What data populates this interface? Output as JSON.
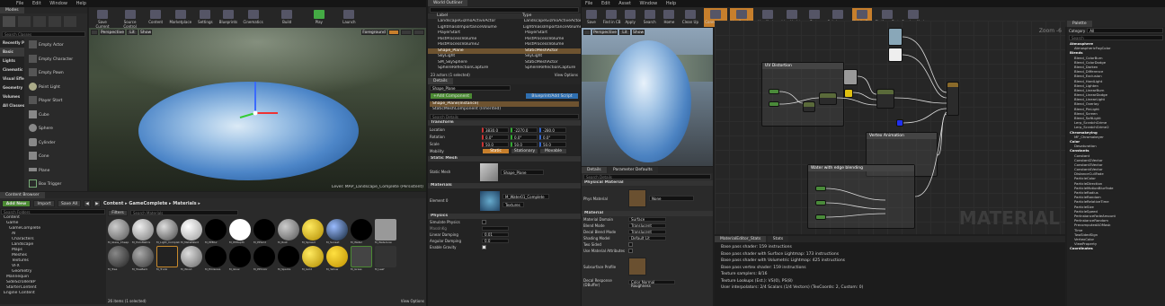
{
  "left": {
    "menu": [
      "File",
      "Edit",
      "Window",
      "Help"
    ],
    "tab": "Modes",
    "search_placeholder": "Search Classes",
    "categories": [
      "Recently Placed",
      "Basic",
      "Lights",
      "Cinematic",
      "Visual Effects",
      "Geometry",
      "Volumes",
      "All Classes"
    ],
    "placeables": [
      "Empty Actor",
      "Empty Character",
      "Empty Pawn",
      "Point Light",
      "Player Start",
      "Cube",
      "Sphere",
      "Cylinder",
      "Cone",
      "Plane",
      "Box Trigger"
    ],
    "toolbar": [
      "Save Current",
      "Source Control",
      "Content",
      "Marketplace",
      "Settings",
      "Blueprints",
      "Cinematics",
      "Build",
      "Play",
      "Launch"
    ],
    "viewport": {
      "perspective": "Perspective",
      "lit": "Lit",
      "show": "Show",
      "foreground": "Foreground",
      "level": "Level: MAP_Landscape_Complete (Persistent)"
    },
    "content_browser": {
      "tab": "Content Browser",
      "add_new": "Add New",
      "import": "Import",
      "save_all": "Save All",
      "path": [
        "Content",
        "GameComplete",
        "Materials"
      ],
      "filters": "Filters",
      "search_placeholder": "Search Materials",
      "folder_search": "Search Folders",
      "tree": [
        "Content",
        "Game",
        "GameComplete",
        "AI",
        "Characters",
        "Landscape",
        "Maps",
        "Meshes",
        "Textures",
        "VFX",
        "Geometry",
        "Mannequin",
        "SideScrollerBP",
        "StarterContent",
        "Engine Content"
      ],
      "assets_row1": [
        "M_Glass_Cheap",
        "M_HoloMatrix",
        "M_Light_Complete",
        "M_MetalWard",
        "M_PPBlur",
        "M_PPDepth",
        "M_PPGrid",
        "M_Rust",
        "M_Spread",
        "M_Sunset",
        "M_Water",
        "M_WaterLow"
      ],
      "assets_row2": [
        "M_Tree",
        "M_TreeBark",
        "M_Trunk",
        "M_Wood",
        "M_Emissive",
        "M_Glow",
        "M_PPColor",
        "M_Sparks",
        "M_Gold",
        "M_Yellow",
        "M_Grass",
        "M_Leaf"
      ],
      "status": "26 items (1 selected)",
      "view_options": "View Options"
    }
  },
  "outliner": {
    "tab": "World Outliner",
    "col_label": "Label",
    "col_type": "Type",
    "rows": [
      {
        "label": "LandscapeGizmoActiveActor",
        "type": "LandscapeGizmoActiveActor"
      },
      {
        "label": "LightmassImportanceVolume",
        "type": "LightmassImportanceVolume"
      },
      {
        "label": "PlayerStart",
        "type": "PlayerStart"
      },
      {
        "label": "PostProcessVolume",
        "type": "PostProcessVolume"
      },
      {
        "label": "PostProcessVolume2",
        "type": "PostProcessVolume"
      },
      {
        "label": "Shape_Plane",
        "type": "StaticMeshActor"
      },
      {
        "label": "SkyLight",
        "type": "SkyLight"
      },
      {
        "label": "SM_SkySphere",
        "type": "StaticMeshActor"
      },
      {
        "label": "SphereReflectionCapture",
        "type": "SphereReflectionCapture"
      }
    ],
    "status": "23 actors (1 selected)",
    "view_options": "View Options"
  },
  "details": {
    "tab": "Details",
    "name": "Shape_Plane",
    "add_component": "+Add Component",
    "blueprint": "Blueprint/Add Script",
    "instance": "Shape_Plane(Instance)",
    "component": "StaticMeshComponent (Inherited)",
    "search_placeholder": "Search Details",
    "transform": "Transform",
    "location": {
      "label": "Location",
      "x": "3830.0",
      "y": "-2270.0",
      "z": "-280.0"
    },
    "rotation": {
      "label": "Rotation",
      "x": "0.0°",
      "y": "0.0°",
      "z": "0.0°"
    },
    "scale": {
      "label": "Scale",
      "x": "50.0",
      "y": "50.0",
      "z": "50.0"
    },
    "mobility": {
      "label": "Mobility",
      "opts": [
        "Static",
        "Stationary",
        "Movable"
      ]
    },
    "static_mesh_section": "Static Mesh",
    "static_mesh_label": "Static Mesh",
    "static_mesh_value": "Shape_Plane",
    "materials_section": "Materials",
    "element0": "Element 0",
    "element0_value": "M_Water01_Complete",
    "textures": "Textures",
    "physics_section": "Physics",
    "physics_rows": [
      "Simulate Physics",
      "MassInKg",
      "Linear Damping",
      "Angular Damping",
      "Enable Gravity"
    ],
    "linear_damping": "0.01",
    "angular_damping": "0.0"
  },
  "material": {
    "menu": [
      "File",
      "Edit",
      "Asset",
      "Window",
      "Help"
    ],
    "toolbar": [
      "Save",
      "Find in CB",
      "Apply",
      "Search",
      "Home",
      "Clean Up",
      "Connectors",
      "Live Preview",
      "Live Nodes",
      "Live Update",
      "Stats",
      "Subclasses",
      "Mobile Stats",
      "Platform Stats",
      "Preview Node"
    ],
    "viewport": {
      "perspective": "Perspective",
      "lit": "Lit",
      "show": "Show"
    },
    "details_tab": "Details",
    "params_tab": "Parameter Defaults",
    "search_placeholder": "Search Details",
    "physical_material_section": "Physical Material",
    "phys_material": "Phys Material",
    "phys_value": "None",
    "material_section": "Material",
    "mat_rows": [
      {
        "label": "Material Domain",
        "value": "Surface"
      },
      {
        "label": "Blend Mode",
        "value": "Translucent"
      },
      {
        "label": "Decal Blend Mode",
        "value": "Translucent"
      },
      {
        "label": "Shading Model",
        "value": "Default Lit"
      },
      {
        "label": "Two Sided",
        "value": ""
      },
      {
        "label": "Use Material Attributes",
        "value": ""
      }
    ],
    "subsurface": "Subsurface Profile",
    "decal_response": "Decal Response (DBuffer)",
    "decal_value": "Color Normal Roughness",
    "graph_zoom": "Zoom -6",
    "graph_watermark": "MATERIAL",
    "comments": [
      "UV Distortion",
      "Vertex Animation",
      "Water with edge blending"
    ],
    "stats_tabs": [
      "MaterialEditor_Stats",
      "Stats"
    ],
    "stats_lines": [
      "Base pass shader: 159 instructions",
      "Base pass shader with Surface Lightmap: 173 instructions",
      "Base pass shader with Volumetric Lightmap: 425 instructions",
      "Base pass vertex shader: 159 instructions",
      "Texture samplers: 8/16",
      "Texture Lookups (Est.): VS(0), PS(8)",
      "User interpolators: 2/4 Scalars (1/4 Vectors) (TexCoords: 2, Custom: 0)"
    ]
  },
  "palette": {
    "tab": "Palette",
    "category_label": "Category",
    "category_value": "All",
    "search_placeholder": "Search",
    "items": [
      {
        "t": "h",
        "v": "Atmosphere"
      },
      {
        "t": "i",
        "v": "AtmosphericFogColor"
      },
      {
        "t": "h",
        "v": "Blends"
      },
      {
        "t": "i",
        "v": "Blend_ColorBurn"
      },
      {
        "t": "i",
        "v": "Blend_ColorDodge"
      },
      {
        "t": "i",
        "v": "Blend_Darken"
      },
      {
        "t": "i",
        "v": "Blend_Difference"
      },
      {
        "t": "i",
        "v": "Blend_Exclusion"
      },
      {
        "t": "i",
        "v": "Blend_HardLight"
      },
      {
        "t": "i",
        "v": "Blend_Lighten"
      },
      {
        "t": "i",
        "v": "Blend_LinearBurn"
      },
      {
        "t": "i",
        "v": "Blend_LinearDodge"
      },
      {
        "t": "i",
        "v": "Blend_LinearLight"
      },
      {
        "t": "i",
        "v": "Blend_Overlay"
      },
      {
        "t": "i",
        "v": "Blend_PinLight"
      },
      {
        "t": "i",
        "v": "Blend_Screen"
      },
      {
        "t": "i",
        "v": "Blend_SoftLight"
      },
      {
        "t": "i",
        "v": "Lerp_ScratchGrime"
      },
      {
        "t": "i",
        "v": "Lerp_ScratchGrime2"
      },
      {
        "t": "h",
        "v": "Chromakeying"
      },
      {
        "t": "i",
        "v": "MF_Chromakeyer"
      },
      {
        "t": "h",
        "v": "Color"
      },
      {
        "t": "i",
        "v": "Desaturation"
      },
      {
        "t": "h",
        "v": "Constants"
      },
      {
        "t": "i",
        "v": "Constant"
      },
      {
        "t": "i",
        "v": "Constant2Vector"
      },
      {
        "t": "i",
        "v": "Constant3Vector"
      },
      {
        "t": "i",
        "v": "Constant4Vector"
      },
      {
        "t": "i",
        "v": "DistanceCullFade"
      },
      {
        "t": "i",
        "v": "ParticleColor"
      },
      {
        "t": "i",
        "v": "ParticleDirection"
      },
      {
        "t": "i",
        "v": "ParticleMotionBlurFade"
      },
      {
        "t": "i",
        "v": "ParticleRadius"
      },
      {
        "t": "i",
        "v": "ParticleRandom"
      },
      {
        "t": "i",
        "v": "ParticleRelativeTime"
      },
      {
        "t": "i",
        "v": "ParticleSize"
      },
      {
        "t": "i",
        "v": "ParticleSpeed"
      },
      {
        "t": "i",
        "v": "PerInstanceFadeAmount"
      },
      {
        "t": "i",
        "v": "PerInstanceRandom"
      },
      {
        "t": "i",
        "v": "PrecomputedAOMask"
      },
      {
        "t": "i",
        "v": "Time"
      },
      {
        "t": "i",
        "v": "TwoSidedSign"
      },
      {
        "t": "i",
        "v": "VertexColor"
      },
      {
        "t": "i",
        "v": "ViewProperty"
      },
      {
        "t": "h",
        "v": "Coordinates"
      }
    ]
  }
}
